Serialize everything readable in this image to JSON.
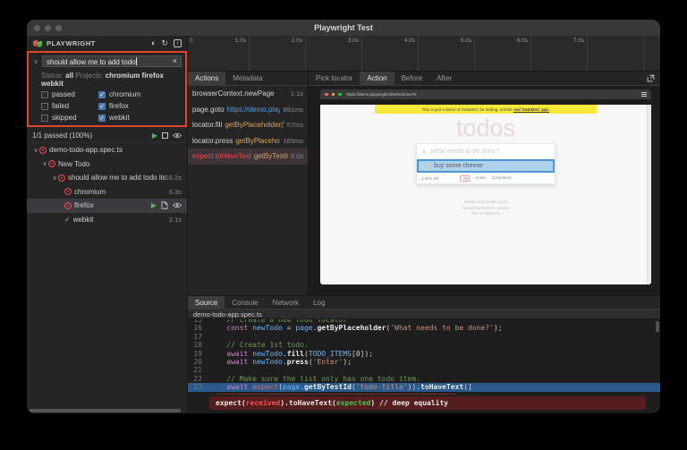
{
  "window": {
    "title": "Playwright Test"
  },
  "sidebar": {
    "brand": "PLAYWRIGHT",
    "header_icons": [
      "theme-toggle-icon",
      "reload-icon",
      "terminal-icon"
    ],
    "search": {
      "value": "should allow me to add todo",
      "clear_label": "×"
    },
    "filters": {
      "status_label": "Status:",
      "status_value": "all",
      "projects_label": "Projects:",
      "projects_value": "chromium firefox webkit",
      "checkboxes": [
        {
          "label": "passed",
          "checked": false
        },
        {
          "label": "chromium",
          "checked": true
        },
        {
          "label": "failed",
          "checked": false
        },
        {
          "label": "firefox",
          "checked": true
        },
        {
          "label": "skipped",
          "checked": false
        },
        {
          "label": "webkit",
          "checked": true
        }
      ]
    },
    "summary": "1/1 passed (100%)",
    "tree": [
      {
        "label": "demo-todo-app.spec.ts",
        "icon": "fail",
        "twisty": true,
        "indent": 0,
        "duration": ""
      },
      {
        "label": "New Todo",
        "icon": "fail",
        "twisty": true,
        "indent": 1,
        "duration": ""
      },
      {
        "label": "should allow me to add todo ite...",
        "icon": "fail",
        "twisty": true,
        "indent": 2,
        "duration": "16.2s"
      },
      {
        "label": "chromium",
        "icon": "fail",
        "twisty": false,
        "indent": 3,
        "duration": "6.3s"
      },
      {
        "label": "firefox",
        "icon": "fail",
        "twisty": false,
        "indent": 3,
        "duration": "",
        "selected": true,
        "row_icons": true
      },
      {
        "label": "webkit",
        "icon": "pass",
        "twisty": false,
        "indent": 3,
        "duration": "2.1s"
      }
    ]
  },
  "timeline": {
    "ticks": [
      "0",
      "1.0s",
      "2.0s",
      "3.0s",
      "4.0s",
      "5.0s",
      "6.0s",
      "7.0s"
    ]
  },
  "actions_panel": {
    "tabs": [
      {
        "label": "Actions",
        "selected": true
      },
      {
        "label": "Metadata",
        "selected": false
      }
    ],
    "items": [
      {
        "title": "browserContext.newPage",
        "duration": "1.1s"
      },
      {
        "title": "page.goto",
        "link": "https://demo.playw...",
        "duration": "891ms"
      },
      {
        "title": "locator.fill",
        "locator": "getByPlaceholder('W...",
        "duration": "57ms"
      },
      {
        "title": "locator.press",
        "locator": "getByPlaceholde...",
        "duration": "165ms"
      },
      {
        "title": "expect.toHaveText",
        "locator": "getByTestId('...",
        "duration": "5.0s",
        "selected": true
      }
    ]
  },
  "inspector": {
    "tabs": [
      {
        "label": "Pick locator",
        "selected": false
      },
      {
        "label": "Action",
        "selected": true
      },
      {
        "label": "Before",
        "selected": false
      },
      {
        "label": "After",
        "selected": false
      }
    ],
    "browser": {
      "url": "https://demo.playwright.dev/todomvc/#/",
      "banner_text": "This is just a demo of TodoMVC for testing, not the ",
      "banner_link": "real TodoMVC app.",
      "heading": "todos",
      "input_placeholder": "What needs to be done?",
      "todo_item": "buy some cheese",
      "items_left": "1 item left",
      "filter_all": "All",
      "filter_active": "Active",
      "filter_completed": "Completed",
      "footnotes": [
        "Double-click to edit a todo",
        "Created by Remo H. Jansen",
        "Part of TodoMVC"
      ]
    }
  },
  "source_panel": {
    "tabs": [
      {
        "label": "Source",
        "selected": true
      },
      {
        "label": "Console",
        "selected": false
      },
      {
        "label": "Network",
        "selected": false
      },
      {
        "label": "Log",
        "selected": false
      }
    ],
    "filename": "demo-todo-app.spec.ts",
    "code": [
      {
        "num": "15",
        "segments": [
          {
            "t": "    // Create a new todo locator",
            "c": "cm"
          }
        ]
      },
      {
        "num": "16",
        "segments": [
          {
            "t": "    "
          },
          {
            "t": "const",
            "c": "kw"
          },
          {
            "t": " "
          },
          {
            "t": "newTodo",
            "c": "vr"
          },
          {
            "t": " = "
          },
          {
            "t": "page",
            "c": "vr"
          },
          {
            "t": "."
          },
          {
            "t": "getByPlaceholder",
            "c": "fn"
          },
          {
            "t": "("
          },
          {
            "t": "'What needs to be done?'",
            "c": "st"
          },
          {
            "t": ");"
          }
        ]
      },
      {
        "num": "17",
        "segments": []
      },
      {
        "num": "18",
        "segments": [
          {
            "t": "    // Create 1st todo.",
            "c": "cm"
          }
        ]
      },
      {
        "num": "19",
        "segments": [
          {
            "t": "    "
          },
          {
            "t": "await",
            "c": "kw"
          },
          {
            "t": " "
          },
          {
            "t": "newTodo",
            "c": "vr"
          },
          {
            "t": "."
          },
          {
            "t": "fill",
            "c": "fn"
          },
          {
            "t": "("
          },
          {
            "t": "TODO_ITEMS",
            "c": "vr"
          },
          {
            "t": "[0]);"
          }
        ]
      },
      {
        "num": "20",
        "segments": [
          {
            "t": "    "
          },
          {
            "t": "await",
            "c": "kw"
          },
          {
            "t": " "
          },
          {
            "t": "newTodo",
            "c": "vr"
          },
          {
            "t": "."
          },
          {
            "t": "press",
            "c": "fn"
          },
          {
            "t": "("
          },
          {
            "t": "'Enter'",
            "c": "st"
          },
          {
            "t": ");"
          }
        ]
      },
      {
        "num": "21",
        "segments": []
      },
      {
        "num": "22",
        "segments": [
          {
            "t": "    // Make sure the list only has one todo item.",
            "c": "cm"
          }
        ]
      },
      {
        "num": "23",
        "highlighted": true,
        "segments": [
          {
            "t": "    "
          },
          {
            "t": "await",
            "c": "kw"
          },
          {
            "t": " "
          },
          {
            "t": "expect",
            "c": "er"
          },
          {
            "t": "("
          },
          {
            "t": "page",
            "c": "vr"
          },
          {
            "t": "."
          },
          {
            "t": "getByTestId",
            "c": "fn"
          },
          {
            "t": "("
          },
          {
            "t": "'todo-title'",
            "c": "st"
          },
          {
            "t": "))."
          },
          {
            "t": "toHaveText",
            "c": "fn"
          },
          {
            "t": "(["
          }
        ]
      }
    ],
    "error_segments": [
      {
        "t": "expect("
      },
      {
        "t": "received",
        "c": "red"
      },
      {
        "t": ")."
      },
      {
        "t": "toHaveText("
      },
      {
        "t": "expected",
        "c": "grn"
      },
      {
        "t": ") "
      },
      {
        "t": "// deep equality"
      }
    ]
  },
  "colors": {
    "accent_red": "#e2442e",
    "fail": "#f14c4c",
    "pass": "#73c991",
    "link": "#4ea1f0",
    "locator": "#d7a65f"
  }
}
